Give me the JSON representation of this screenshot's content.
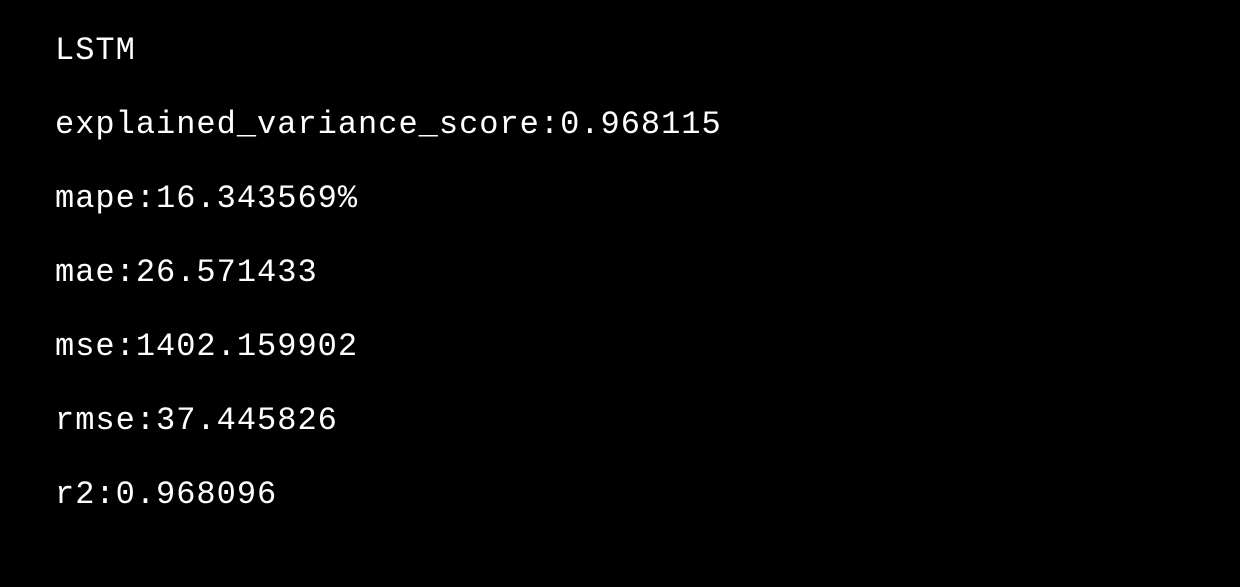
{
  "console": {
    "title": "LSTM",
    "metrics": [
      {
        "label": "explained_variance_score",
        "sep": ":",
        "value": "0.968115"
      },
      {
        "label": "mape",
        "sep": ":",
        "value": "16.343569%"
      },
      {
        "label": "mae",
        "sep": ":",
        "value": "26.571433"
      },
      {
        "label": "mse",
        "sep": ":",
        "value": "1402.159902"
      },
      {
        "label": "rmse",
        "sep": ":",
        "value": "37.445826"
      },
      {
        "label": "r2",
        "sep": ":",
        "value": "0.968096"
      }
    ]
  }
}
